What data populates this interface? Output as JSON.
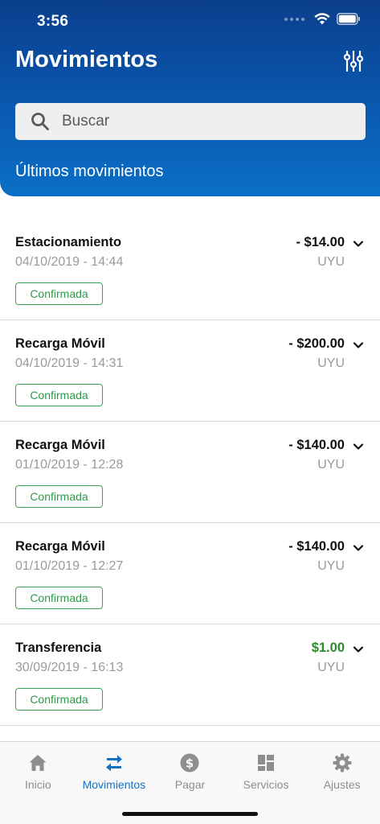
{
  "status_bar": {
    "time": "3:56"
  },
  "header": {
    "title": "Movimientos"
  },
  "search": {
    "placeholder": "Buscar"
  },
  "section": {
    "title": "Últimos movimientos"
  },
  "transactions": [
    {
      "name": "Estacionamiento",
      "date": "04/10/2019 - 14:44",
      "amount": "- $14.00",
      "currency": "UYU",
      "status": "Confirmada",
      "type": "debit"
    },
    {
      "name": "Recarga Móvil",
      "date": "04/10/2019 - 14:31",
      "amount": "- $200.00",
      "currency": "UYU",
      "status": "Confirmada",
      "type": "debit"
    },
    {
      "name": "Recarga Móvil",
      "date": "01/10/2019 - 12:28",
      "amount": "- $140.00",
      "currency": "UYU",
      "status": "Confirmada",
      "type": "debit"
    },
    {
      "name": "Recarga Móvil",
      "date": "01/10/2019 - 12:27",
      "amount": "- $140.00",
      "currency": "UYU",
      "status": "Confirmada",
      "type": "debit"
    },
    {
      "name": "Transferencia",
      "date": "30/09/2019 - 16:13",
      "amount": "$1.00",
      "currency": "UYU",
      "status": "Confirmada",
      "type": "credit"
    }
  ],
  "tabbar": {
    "items": [
      {
        "label": "Inicio",
        "icon": "home-icon"
      },
      {
        "label": "Movimientos",
        "icon": "transfer-arrows-icon",
        "active": true
      },
      {
        "label": "Pagar",
        "icon": "dollar-circle-icon"
      },
      {
        "label": "Servicios",
        "icon": "dashboard-icon"
      },
      {
        "label": "Ajustes",
        "icon": "gear-icon"
      }
    ]
  },
  "colors": {
    "header_top": "#0b3f8c",
    "header_bottom": "#0a6fc6",
    "accent": "#1472c4",
    "confirmed": "#3aa655",
    "credit": "#2b8a2b"
  }
}
